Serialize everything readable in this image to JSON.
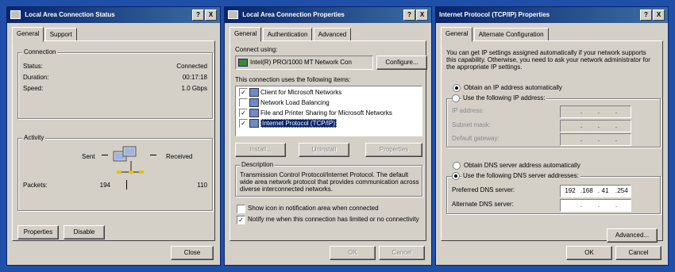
{
  "status_window": {
    "title": "Local Area Connection Status",
    "help_btn": "?",
    "close_btn": "X",
    "tabs": [
      "General",
      "Support"
    ],
    "connection": {
      "legend": "Connection",
      "rows": [
        {
          "label": "Status:",
          "value": "Connected"
        },
        {
          "label": "Duration:",
          "value": "00:17:18"
        },
        {
          "label": "Speed:",
          "value": "1.0 Gbps"
        }
      ]
    },
    "activity": {
      "legend": "Activity",
      "sent_label": "Sent",
      "received_label": "Received",
      "packets_label": "Packets:",
      "sent_value": "194",
      "received_value": "110"
    },
    "properties_btn": "Properties",
    "disable_btn": "Disable",
    "close_action": "Close"
  },
  "props_window": {
    "title": "Local Area Connection Properties",
    "help_btn": "?",
    "close_btn": "X",
    "tabs": [
      "General",
      "Authentication",
      "Advanced"
    ],
    "connect_using_label": "Connect using:",
    "adapter": "Intel(R) PRO/1000 MT Network Con",
    "configure_btn": "Configure...",
    "items_label": "This connection uses the following items:",
    "items": [
      {
        "label": "Client for Microsoft Networks",
        "checked": true
      },
      {
        "label": "Network Load Balancing",
        "checked": false
      },
      {
        "label": "File and Printer Sharing for Microsoft Networks",
        "checked": true
      },
      {
        "label": "Internet Protocol (TCP/IP)",
        "checked": true
      }
    ],
    "install_btn": "Install...",
    "uninstall_btn": "Uninstall",
    "properties_btn": "Properties",
    "description_legend": "Description",
    "description_text": "Transmission Control Protocol/Internet Protocol. The default wide area network protocol that provides communication across diverse interconnected networks.",
    "show_icon_label": "Show icon in notification area when connected",
    "notify_label": "Notify me when this connection has limited or no connectivity",
    "ok_btn": "OK",
    "cancel_btn": "Cancel"
  },
  "tcpip_window": {
    "title": "Internet Protocol (TCP/IP) Properties",
    "help_btn": "?",
    "close_btn": "X",
    "tabs": [
      "General",
      "Alternate Configuration"
    ],
    "intro": "You can get IP settings assigned automatically if your network supports this capability. Otherwise, you need to ask your network administrator for the appropriate IP settings.",
    "obtain_ip_auto": "Obtain an IP address automatically",
    "use_following_ip": "Use the following IP address:",
    "ip_address_label": "IP address:",
    "subnet_label": "Subnet mask:",
    "gateway_label": "Default gateway:",
    "empty_ip": [
      ".",
      ".",
      "."
    ],
    "obtain_dns_auto": "Obtain DNS server address automatically",
    "use_following_dns": "Use the following DNS server addresses:",
    "preferred_dns_label": "Preferred DNS server:",
    "preferred_dns_octets": [
      "192",
      "168",
      "41",
      "254"
    ],
    "alternate_dns_label": "Alternate DNS server:",
    "advanced_btn": "Advanced...",
    "ok_btn": "OK",
    "cancel_btn": "Cancel"
  }
}
